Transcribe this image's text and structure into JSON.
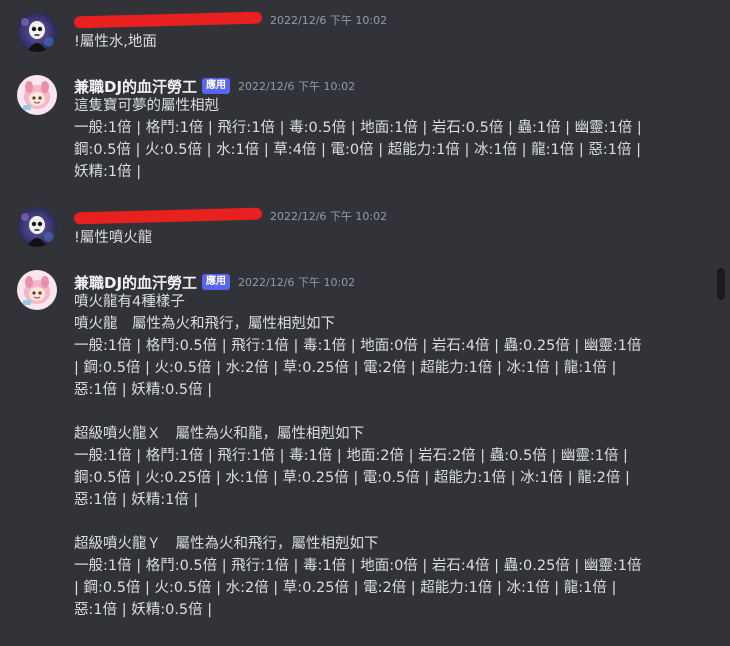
{
  "messages": [
    {
      "author": "",
      "redacted": true,
      "badge": "",
      "timestamp": "2022/12/6 下午 10:02",
      "lines": [
        "!屬性水,地面"
      ]
    },
    {
      "author": "兼職DJ的血汗勞工",
      "redacted": false,
      "badge": "應用",
      "timestamp": "2022/12/6 下午 10:02",
      "lines": [
        "這隻寶可夢的屬性相剋",
        "一般:1倍 | 格鬥:1倍 | 飛行:1倍 | 毒:0.5倍 | 地面:1倍 | 岩石:0.5倍 | 蟲:1倍 | 幽靈:1倍 |",
        "鋼:0.5倍 | 火:0.5倍 | 水:1倍 | 草:4倍 | 電:0倍 | 超能力:1倍 | 冰:1倍 | 龍:1倍 | 惡:1倍 |",
        "妖精:1倍 |"
      ]
    },
    {
      "author": "",
      "redacted": true,
      "badge": "",
      "timestamp": "2022/12/6 下午 10:02",
      "lines": [
        "!屬性噴火龍"
      ]
    },
    {
      "author": "兼職DJ的血汗勞工",
      "redacted": false,
      "badge": "應用",
      "timestamp": "2022/12/6 下午 10:02",
      "lines": [
        "噴火龍有4種樣子",
        "噴火龍　屬性為火和飛行，屬性相剋如下",
        "一般:1倍 | 格鬥:0.5倍 | 飛行:1倍 | 毒:1倍 | 地面:0倍 | 岩石:4倍 | 蟲:0.25倍 | 幽靈:1倍",
        " | 鋼:0.5倍 | 火:0.5倍 | 水:2倍 | 草:0.25倍 | 電:2倍 | 超能力:1倍 | 冰:1倍 | 龍:1倍 |",
        "惡:1倍 | 妖精:0.5倍 |",
        "",
        "超級噴火龍Ｘ　屬性為火和龍，屬性相剋如下",
        "一般:1倍 | 格鬥:1倍 | 飛行:1倍 | 毒:1倍 | 地面:2倍 | 岩石:2倍 | 蟲:0.5倍 | 幽靈:1倍 |",
        "鋼:0.5倍 | 火:0.25倍 | 水:1倍 | 草:0.25倍 | 電:0.5倍 | 超能力:1倍 | 冰:1倍 | 龍:2倍 |",
        "惡:1倍 | 妖精:1倍 |",
        "",
        "超級噴火龍Ｙ　屬性為火和飛行，屬性相剋如下",
        "一般:1倍 | 格鬥:0.5倍 | 飛行:1倍 | 毒:1倍 | 地面:0倍 | 岩石:4倍 | 蟲:0.25倍 | 幽靈:1倍",
        " | 鋼:0.5倍 | 火:0.5倍 | 水:2倍 | 草:0.25倍 | 電:2倍 | 超能力:1倍 | 冰:1倍 | 龍:1倍 |",
        "惡:1倍 | 妖精:0.5倍 |"
      ]
    }
  ],
  "colors": {
    "background": "#313338",
    "text": "#dbdee1",
    "username": "#f2f3f5",
    "timestamp": "#949ba4",
    "badge": "#5865f2",
    "redaction": "#e8201f"
  }
}
